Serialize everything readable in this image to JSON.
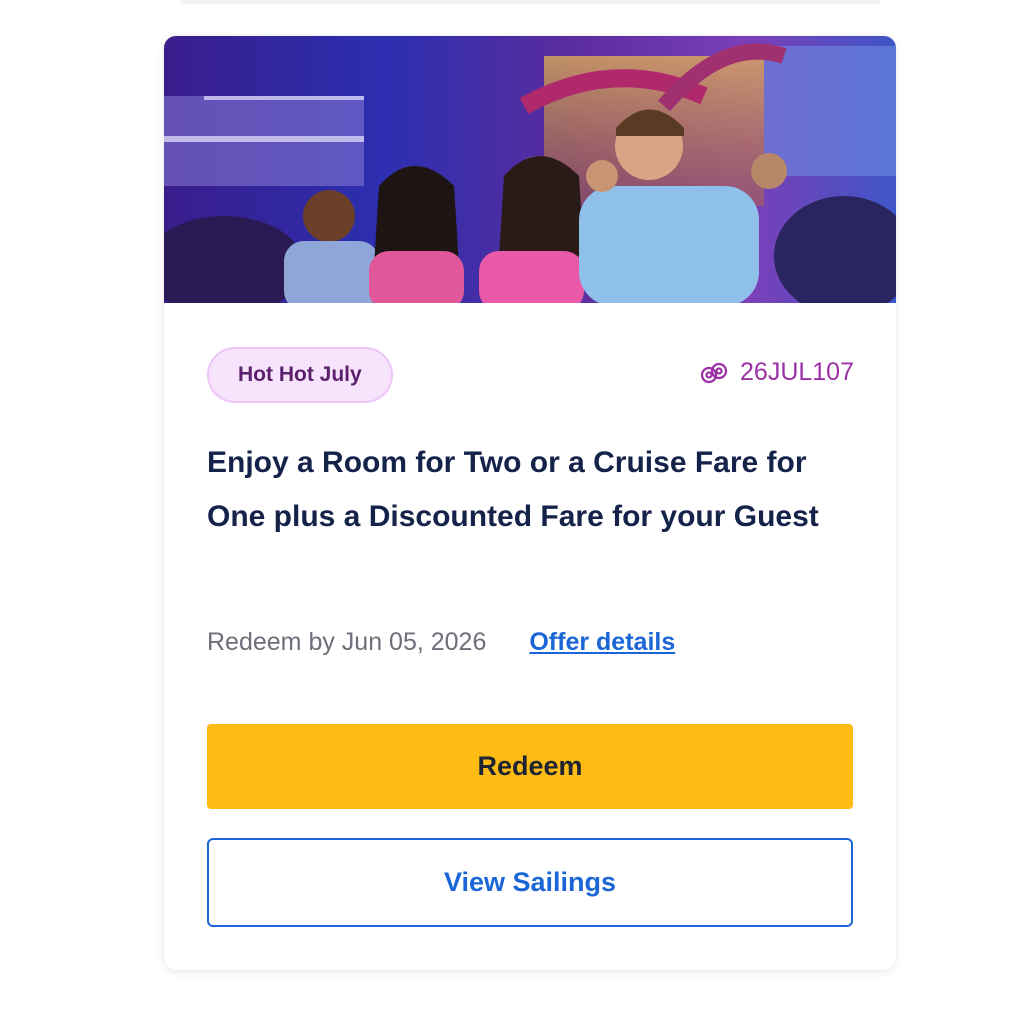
{
  "offer": {
    "hero_image_alt": "Group of guests smiling at a night show aboard a cruise ship",
    "tag_label": "Hot Hot July",
    "code_icon": "gift-icon",
    "offer_code": "26JUL107",
    "title": "Enjoy a Room for Two or a Cruise Fare for One plus a Discounted Fare for your Guest",
    "redeem_by": "Redeem by Jun 05, 2026",
    "details_link": "Offer details"
  },
  "actions": {
    "redeem_label": "Redeem",
    "view_sailings_label": "View Sailings"
  },
  "colors": {
    "accent_yellow": "#fdbb14",
    "link_blue": "#1a66d6",
    "title_navy": "#15224a",
    "tag_bg": "#f7e3fb",
    "code_purple": "#9b30a6"
  }
}
